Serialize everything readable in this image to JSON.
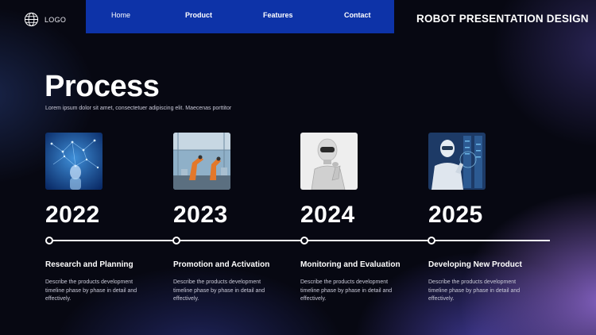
{
  "logo": {
    "label": "LOGO",
    "icon": "globe-icon"
  },
  "nav": {
    "items": [
      "Home",
      "Product",
      "Features",
      "Contact"
    ]
  },
  "brand": {
    "title": "ROBOT PRESENTATION DESIGN"
  },
  "section": {
    "title": "Process",
    "subtitle": "Lorem ipsum dolor sit amet, consectetuer adipiscing elit. Maecenas porttitor"
  },
  "timeline": {
    "steps": [
      {
        "year": "2022",
        "title": "Research and Planning",
        "desc": "Describe the products development timeline phase by phase in detail and effectively."
      },
      {
        "year": "2023",
        "title": "Promotion and Activation",
        "desc": "Describe the products development timeline phase by phase in detail and effectively."
      },
      {
        "year": "2024",
        "title": "Monitoring and Evaluation",
        "desc": "Describe the products development timeline phase by phase in detail and effectively."
      },
      {
        "year": "2025",
        "title": "Developing New Product",
        "desc": "Describe the products development timeline phase by phase in detail and effectively."
      }
    ]
  },
  "colors": {
    "nav_bg": "#0d33a8",
    "background": "#070812",
    "accent_purple": "#8a66d6"
  }
}
